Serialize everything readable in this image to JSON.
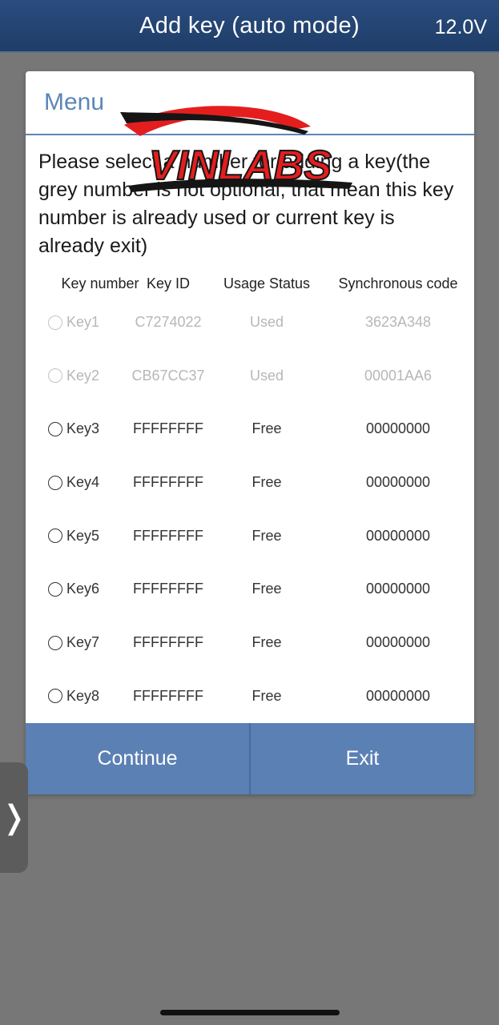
{
  "header": {
    "title": "Add key (auto mode)",
    "voltage": "12.0V"
  },
  "dialog": {
    "title": "Menu",
    "message": "Please select a number for adding a key(the grey number is not optional, that mean this key number is already used or current key is already exit)",
    "columns": [
      "Key number",
      "Key ID",
      "Usage Status",
      "Synchronous code"
    ],
    "keys": [
      {
        "key": "Key1",
        "id": "C7274022",
        "status": "Used",
        "sync": "3623A348"
      },
      {
        "key": "Key2",
        "id": "CB67CC37",
        "status": "Used",
        "sync": "00001AA6"
      },
      {
        "key": "Key3",
        "id": "FFFFFFFF",
        "status": "Free",
        "sync": "00000000"
      },
      {
        "key": "Key4",
        "id": "FFFFFFFF",
        "status": "Free",
        "sync": "00000000"
      },
      {
        "key": "Key5",
        "id": "FFFFFFFF",
        "status": "Free",
        "sync": "00000000"
      },
      {
        "key": "Key6",
        "id": "FFFFFFFF",
        "status": "Free",
        "sync": "00000000"
      },
      {
        "key": "Key7",
        "id": "FFFFFFFF",
        "status": "Free",
        "sync": "00000000"
      },
      {
        "key": "Key8",
        "id": "FFFFFFFF",
        "status": "Free",
        "sync": "00000000"
      }
    ],
    "buttons": {
      "continue": "Continue",
      "exit": "Exit"
    }
  },
  "watermark": "VINLABS",
  "side_handle_icon": "chevron-right-icon",
  "colors": {
    "accent": "#5b86b8",
    "header_bg": "#2a4d7f",
    "button_bg": "#5b80b4"
  }
}
